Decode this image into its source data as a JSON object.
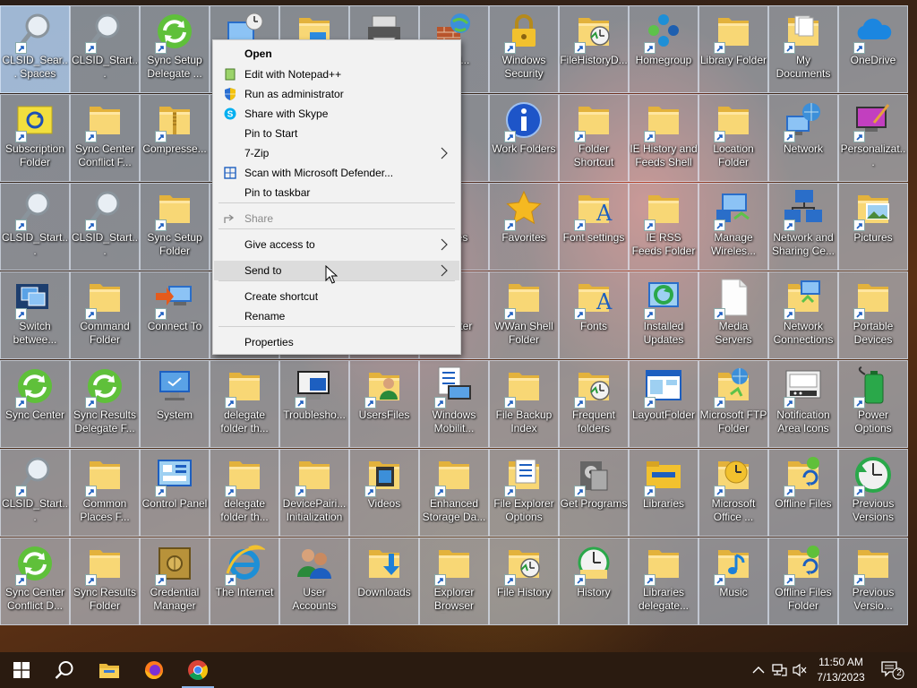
{
  "desktop": {
    "icons": [
      {
        "label": "CLSID_Sear... Spaces",
        "icon": "search-magnifier",
        "selected": true
      },
      {
        "label": "CLSID_Start...",
        "icon": "search-magnifier"
      },
      {
        "label": "Sync Setup Delegate ...",
        "icon": "sync-green"
      },
      {
        "label": "",
        "icon": "computer-clock"
      },
      {
        "label": "",
        "icon": "folder-blue"
      },
      {
        "label": "",
        "icon": "printer"
      },
      {
        "label": "ws d...",
        "icon": "firewall-globe"
      },
      {
        "label": "Windows Security",
        "icon": "lock"
      },
      {
        "label": "FileHistoryD...",
        "icon": "folder-clock"
      },
      {
        "label": "Homegroup",
        "icon": "homegroup"
      },
      {
        "label": "Library Folder",
        "icon": "folder"
      },
      {
        "label": "My Documents",
        "icon": "folder-docs"
      },
      {
        "label": "OneDrive",
        "icon": "cloud"
      },
      {
        "label": "Subscription Folder",
        "icon": "sync-folder-yellow"
      },
      {
        "label": "Sync Center Conflict F...",
        "icon": "folder"
      },
      {
        "label": "Compresse...",
        "icon": "folder-zip"
      },
      {
        "label": "",
        "icon": "none"
      },
      {
        "label": "",
        "icon": "none"
      },
      {
        "label": "",
        "icon": "none"
      },
      {
        "label": "P",
        "icon": "none"
      },
      {
        "label": "Work Folders",
        "icon": "info-blue"
      },
      {
        "label": "Folder Shortcut",
        "icon": "folder"
      },
      {
        "label": "IE History and Feeds Shell ...",
        "icon": "folder"
      },
      {
        "label": "Location Folder",
        "icon": "folder"
      },
      {
        "label": "Network",
        "icon": "network-globe"
      },
      {
        "label": "Personalizat...",
        "icon": "monitor-brush"
      },
      {
        "label": "CLSID_Start...",
        "icon": "search-magnifier"
      },
      {
        "label": "CLSID_Start...",
        "icon": "search-magnifier"
      },
      {
        "label": "Sync Setup Folder",
        "icon": "folder"
      },
      {
        "label": "",
        "icon": "none"
      },
      {
        "label": "",
        "icon": "none"
      },
      {
        "label": "",
        "icon": "none"
      },
      {
        "label": "ws es",
        "icon": "none"
      },
      {
        "label": "Favorites",
        "icon": "star"
      },
      {
        "label": "Font settings",
        "icon": "folder-font"
      },
      {
        "label": "IE RSS Feeds Folder",
        "icon": "folder"
      },
      {
        "label": "Manage Wireles...",
        "icon": "wireless-network"
      },
      {
        "label": "Network and Sharing Ce...",
        "icon": "network-sharing"
      },
      {
        "label": "Pictures",
        "icon": "folder-pictures"
      },
      {
        "label": "Switch betwee...",
        "icon": "switch-windows"
      },
      {
        "label": "Command Folder",
        "icon": "folder"
      },
      {
        "label": "Connect To",
        "icon": "connect-to"
      },
      {
        "label": "",
        "icon": "none"
      },
      {
        "label": "",
        "icon": "none"
      },
      {
        "label": "",
        "icon": "none"
      },
      {
        "label": "of enter",
        "icon": "none"
      },
      {
        "label": "WWan Shell Folder",
        "icon": "folder"
      },
      {
        "label": "Fonts",
        "icon": "folder-font"
      },
      {
        "label": "Installed Updates",
        "icon": "updates"
      },
      {
        "label": "Media Servers",
        "icon": "blank-doc"
      },
      {
        "label": "Network Connections",
        "icon": "network-connections"
      },
      {
        "label": "Portable Devices",
        "icon": "folder"
      },
      {
        "label": "Sync Center",
        "icon": "sync-green"
      },
      {
        "label": "Sync Results Delegate F...",
        "icon": "sync-green"
      },
      {
        "label": "System",
        "icon": "system-monitor"
      },
      {
        "label": "delegate folder th...",
        "icon": "folder"
      },
      {
        "label": "Troublesho...",
        "icon": "troubleshoot"
      },
      {
        "label": "UsersFiles",
        "icon": "folder-user"
      },
      {
        "label": "Windows Mobilit...",
        "icon": "mobility"
      },
      {
        "label": "File Backup Index",
        "icon": "folder"
      },
      {
        "label": "Frequent folders",
        "icon": "folder-clock"
      },
      {
        "label": "LayoutFolder",
        "icon": "layout-window"
      },
      {
        "label": "Microsoft FTP Folder",
        "icon": "folder-globe"
      },
      {
        "label": "Notification Area Icons",
        "icon": "notification-area"
      },
      {
        "label": "Power Options",
        "icon": "battery"
      },
      {
        "label": "CLSID_Start...",
        "icon": "search-magnifier"
      },
      {
        "label": "Common Places F...",
        "icon": "folder"
      },
      {
        "label": "Control Panel",
        "icon": "control-panel"
      },
      {
        "label": "delegate folder th...",
        "icon": "folder"
      },
      {
        "label": "DevicePairi... Initialization",
        "icon": "folder"
      },
      {
        "label": "Videos",
        "icon": "folder-film"
      },
      {
        "label": "Enhanced Storage Da...",
        "icon": "folder"
      },
      {
        "label": "File Explorer Options",
        "icon": "folder-options"
      },
      {
        "label": "Get Programs",
        "icon": "get-programs"
      },
      {
        "label": "Libraries",
        "icon": "folder-libraries"
      },
      {
        "label": "Microsoft Office ...",
        "icon": "folder-clock-yellow"
      },
      {
        "label": "Offline Files",
        "icon": "folder-sync"
      },
      {
        "label": "Previous Versions",
        "icon": "clock-green"
      },
      {
        "label": "Sync Center Conflict D...",
        "icon": "sync-green"
      },
      {
        "label": "Sync Results Folder",
        "icon": "folder"
      },
      {
        "label": "Credential Manager",
        "icon": "safe"
      },
      {
        "label": "The Internet",
        "icon": "ie"
      },
      {
        "label": "User Accounts",
        "icon": "users"
      },
      {
        "label": "Downloads",
        "icon": "folder-download"
      },
      {
        "label": "Explorer Browser Res...",
        "icon": "folder"
      },
      {
        "label": "File History",
        "icon": "folder-clock"
      },
      {
        "label": "History",
        "icon": "history"
      },
      {
        "label": "Libraries delegate...",
        "icon": "folder"
      },
      {
        "label": "Music",
        "icon": "folder-music"
      },
      {
        "label": "Offline Files Folder",
        "icon": "folder-sync"
      },
      {
        "label": "Previous Versio...",
        "icon": "folder"
      }
    ]
  },
  "context_menu": {
    "items": [
      {
        "label": "Open",
        "bold": true
      },
      {
        "label": "Edit with Notepad++",
        "icon": "notepadpp-icon"
      },
      {
        "label": "Run as administrator",
        "icon": "uac-shield-icon"
      },
      {
        "label": "Share with Skype",
        "icon": "skype-icon"
      },
      {
        "label": "Pin to Start"
      },
      {
        "label": "7-Zip",
        "submenu": true
      },
      {
        "label": "Scan with Microsoft Defender...",
        "icon": "defender-icon"
      },
      {
        "label": "Pin to taskbar"
      },
      {
        "label": "Share",
        "icon": "share-icon",
        "disabled": true
      },
      {
        "label": "Give access to",
        "submenu": true
      },
      {
        "label": "Send to",
        "submenu": true,
        "hover": true
      },
      {
        "label": "Create shortcut"
      },
      {
        "label": "Rename"
      },
      {
        "label": "Properties"
      }
    ]
  },
  "taskbar": {
    "buttons": [
      {
        "name": "start-button",
        "icon": "windows-logo-icon"
      },
      {
        "name": "search-button",
        "icon": "search-icon"
      },
      {
        "name": "file-explorer-button",
        "icon": "folder-icon"
      },
      {
        "name": "firefox-button",
        "icon": "firefox-icon"
      },
      {
        "name": "chrome-button",
        "icon": "chrome-icon",
        "active": true
      }
    ],
    "tray": {
      "time": "11:50 AM",
      "date": "7/13/2023",
      "notification_count": "2"
    }
  }
}
